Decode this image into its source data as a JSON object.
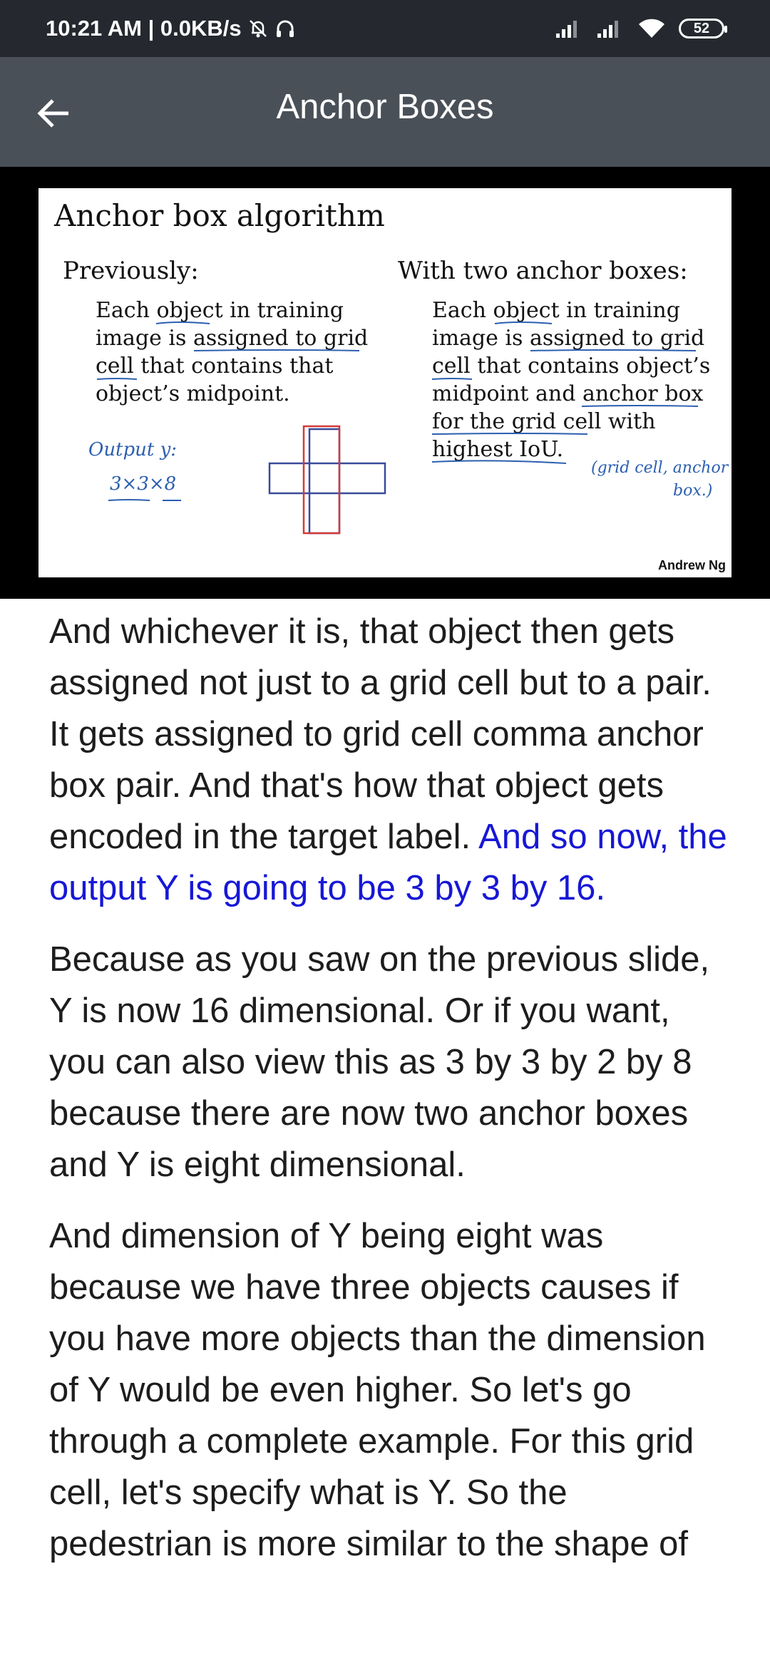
{
  "status_bar": {
    "time_info": "10:21 AM | 0.0KB/s",
    "icons": [
      "alarm-off-icon",
      "headphones-icon",
      "signal-icon",
      "signal-icon",
      "wifi-icon",
      "battery-icon"
    ],
    "battery": "52"
  },
  "app_bar": {
    "back_icon": "arrow-back-icon",
    "title": "Anchor Boxes"
  },
  "slide": {
    "title": "Anchor box algorithm",
    "left_heading": "Previously:",
    "left_lines": [
      "Each object in training",
      "image is assigned to grid",
      "cell that contains that",
      "object’s midpoint."
    ],
    "right_heading": "With two anchor boxes:",
    "right_lines": [
      "Each object in training",
      "image is assigned to grid",
      "cell that contains object’s",
      "midpoint and anchor box",
      "for the grid cell with",
      "highest IoU."
    ],
    "handwriting_output": "Output y:",
    "handwriting_dims": "3×3×8",
    "handwriting_pair_1": "(grid cell, anchor",
    "handwriting_pair_2": "box.)",
    "credit": "Andrew Ng"
  },
  "transcript": {
    "paragraph_1_plain": "And whichever it is, that object then gets assigned not just to a grid cell but to a pair. It gets assigned to grid cell comma anchor box pair. And that's how that object gets encoded in the target label.",
    "paragraph_1_highlight": "And so now, the output Y is going to be 3 by 3 by 16.",
    "paragraph_2": "Because as you saw on the previous slide, Y is now 16 dimensional. Or if you want, you can also view this as 3 by 3 by 2 by 8 because there are now two anchor boxes and Y is eight dimensional.",
    "paragraph_3": "And dimension of Y being eight was because we have three objects causes if you have more objects than the dimension of Y would be even higher. So let's go through a complete example. For this grid cell, let's specify what is Y. So the pedestrian is more similar to the shape of"
  },
  "colors": {
    "status_bar_bg": "#25292f",
    "app_bar_bg": "#4a5058",
    "highlight_text": "#1717d6",
    "annotation_blue": "#2c5fb0",
    "annotation_red": "#d23a3a"
  }
}
